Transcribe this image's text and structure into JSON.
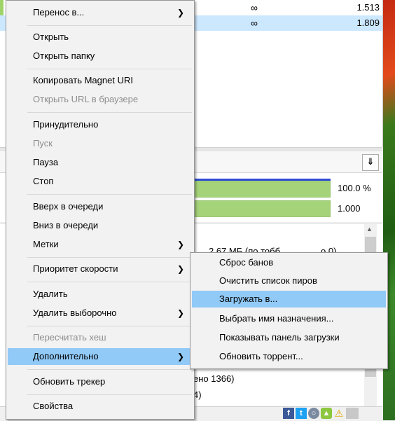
{
  "background": {
    "top_rows": [
      {
        "inf": "∞",
        "value": "1.513"
      },
      {
        "inf": "∞",
        "value": "1.809"
      }
    ],
    "collapse_icon": "double-chevron-down",
    "progress": [
      {
        "value_label": "100.0 %",
        "fill": 1.0
      },
      {
        "value_label": "1.000",
        "fill": 1.0
      }
    ],
    "fragments": {
      "size_fragment": "2.67 МБ (по тобб",
      "size_tail": "о 0)",
      "seeds_fragment": "ено 1366)",
      "peers_fragment": "4)"
    },
    "status_icons": [
      "facebook-icon",
      "twitter-icon",
      "web-icon",
      "android-icon",
      "warning-icon"
    ]
  },
  "context_menu": {
    "items": [
      {
        "label": "Перенос в...",
        "submenu": true,
        "disabled": false
      },
      {
        "sep": true
      },
      {
        "label": "Открыть",
        "submenu": false,
        "disabled": false
      },
      {
        "label": "Открыть папку",
        "submenu": false,
        "disabled": false
      },
      {
        "sep": true
      },
      {
        "label": "Копировать Magnet URI",
        "submenu": false,
        "disabled": false
      },
      {
        "label": "Открыть URL в браузере",
        "submenu": false,
        "disabled": true
      },
      {
        "sep": true
      },
      {
        "label": "Принудительно",
        "submenu": false,
        "disabled": false
      },
      {
        "label": "Пуск",
        "submenu": false,
        "disabled": true
      },
      {
        "label": "Пауза",
        "submenu": false,
        "disabled": false
      },
      {
        "label": "Стоп",
        "submenu": false,
        "disabled": false
      },
      {
        "sep": true
      },
      {
        "label": "Вверх в очереди",
        "submenu": false,
        "disabled": false
      },
      {
        "label": "Вниз в очереди",
        "submenu": false,
        "disabled": false
      },
      {
        "label": "Метки",
        "submenu": true,
        "disabled": false
      },
      {
        "sep": true
      },
      {
        "label": "Приоритет скорости",
        "submenu": true,
        "disabled": false
      },
      {
        "sep": true
      },
      {
        "label": "Удалить",
        "submenu": false,
        "disabled": false
      },
      {
        "label": "Удалить выборочно",
        "submenu": true,
        "disabled": false
      },
      {
        "sep": true
      },
      {
        "label": "Пересчитать хеш",
        "submenu": false,
        "disabled": true
      },
      {
        "label": "Дополнительно",
        "submenu": true,
        "disabled": false,
        "highlighted": true
      },
      {
        "sep": true
      },
      {
        "label": "Обновить трекер",
        "submenu": false,
        "disabled": false
      },
      {
        "sep": true
      },
      {
        "label": "Свойства",
        "submenu": false,
        "disabled": false
      }
    ]
  },
  "submenu": {
    "items": [
      {
        "label": "Сброс банов"
      },
      {
        "label": "Очистить список пиров"
      },
      {
        "label": "Загружать в...",
        "highlighted": true
      },
      {
        "label": "Выбрать имя назначения..."
      },
      {
        "label": "Показывать панель загрузки"
      },
      {
        "label": "Обновить торрент..."
      }
    ]
  },
  "colors": {
    "highlight": "#91c9f7",
    "progress_fill": "#a5d37a",
    "progress_top": "#2d4bd6",
    "disabled_text": "#8d8d8d"
  }
}
